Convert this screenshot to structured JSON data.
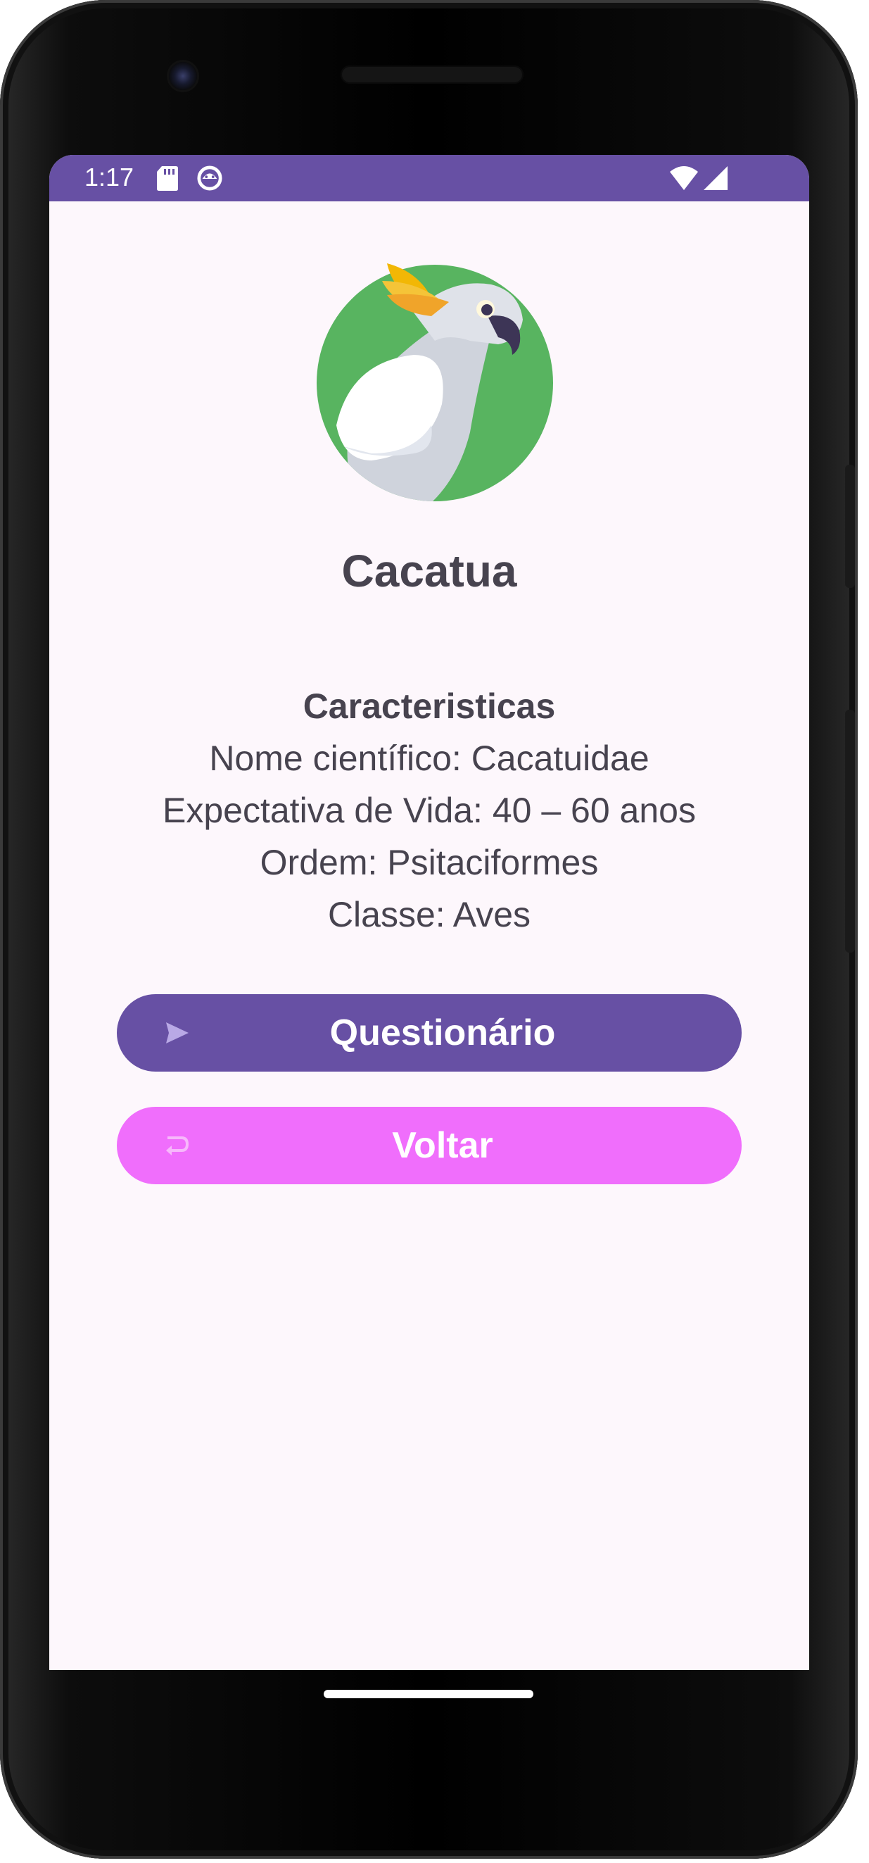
{
  "status_bar": {
    "time": "1:17",
    "bg_color": "#6750a4",
    "icons": [
      "sd-card-icon",
      "android-debug-icon",
      "wifi-icon",
      "signal-icon"
    ]
  },
  "animal": {
    "name": "Cacatua",
    "image_icon": "cockatoo-icon",
    "characteristics": {
      "heading": "Caracteristicas",
      "scientific_name": "Nome científico: Cacatuidae",
      "life_expectancy": "Expectativa de Vida: 40 – 60 anos",
      "order": "Ordem: Psitaciformes",
      "class": "Classe: Aves"
    }
  },
  "buttons": {
    "quiz": {
      "label": "Questionário",
      "icon": "send-icon",
      "color": "#6750a4"
    },
    "back": {
      "label": "Voltar",
      "icon": "undo-icon",
      "color": "#f06efc"
    }
  },
  "theme": {
    "screen_bg": "#fdf7fc",
    "text_color": "#47434f",
    "avatar_bg": "#58b460"
  }
}
